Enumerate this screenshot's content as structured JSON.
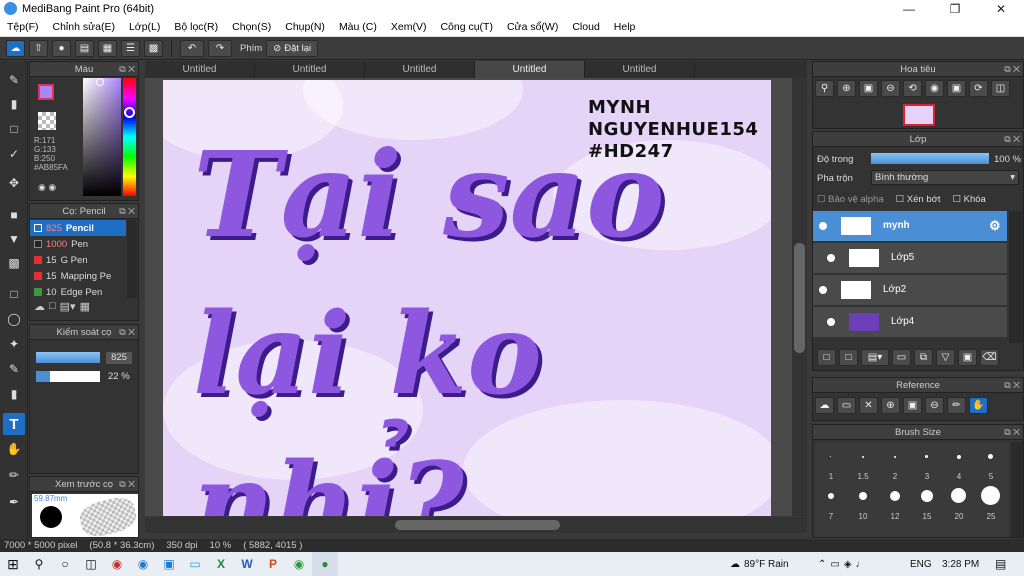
{
  "app": {
    "title": "MediBang Paint Pro (64bit)"
  },
  "menu": [
    "Tệp(F)",
    "Chỉnh sửa(E)",
    "Lớp(L)",
    "Bộ lọc(R)",
    "Chọn(S)",
    "Chụp(N)",
    "Màu (C)",
    "Xem(V)",
    "Công cụ(T)",
    "Cửa sổ(W)",
    "Cloud",
    "Help"
  ],
  "toolbar": {
    "shortcut_label": "Phím",
    "undo_label": "Đặt lại"
  },
  "tabs": [
    "Untitled",
    "Untitled",
    "Untitled",
    "Untitled",
    "Untitled"
  ],
  "color_panel": {
    "title": "Màu",
    "r": "R:171",
    "g": "G:133",
    "b": "B:250",
    "hex": "#AB85FA",
    "current": "#ab85fa"
  },
  "brush_panel": {
    "title": "Cọ: Pencil",
    "items": [
      {
        "size": "825",
        "name": "Pencil",
        "color": "#1e6fc4"
      },
      {
        "size": "1000",
        "name": "Pen",
        "color": "#333"
      },
      {
        "size": "15",
        "name": "G Pen",
        "color": "#e03030"
      },
      {
        "size": "15",
        "name": "Mapping Pe",
        "color": "#e03030"
      },
      {
        "size": "10",
        "name": "Edge Pen",
        "color": "#3a9a3a"
      }
    ]
  },
  "brush_control": {
    "title": "Kiểm soát cọ",
    "size": "825",
    "opacity": "22 %"
  },
  "preview": {
    "title": "Xem trước cọ",
    "value": "59.87mm"
  },
  "art": {
    "sig1": "MYNH",
    "sig2": "NGUYENHUE154",
    "sig3": "#HD247",
    "line1": "Tại sao",
    "line2": "lại ko nhỉ?"
  },
  "navigator": {
    "title": "Hoa tiêu"
  },
  "layer_panel": {
    "title": "Lớp",
    "opacity_label": "Độ trong",
    "opacity_value": "100 %",
    "blend_label": "Pha trộn",
    "blend_value": "Bình thường",
    "alpha_label": "Bảo vệ alpha",
    "clip_label": "Xén bớt",
    "lock_label": "Khóa",
    "layers": [
      "mynh",
      "Lớp5",
      "Lớp2",
      "Lớp4"
    ]
  },
  "reference": {
    "title": "Reference"
  },
  "brush_size": {
    "title": "Brush Size",
    "row1": [
      "1",
      "1.5",
      "2",
      "3",
      "4",
      "5"
    ],
    "row2": [
      "7",
      "10",
      "12",
      "15",
      "20",
      "25"
    ]
  },
  "status": {
    "size": "7000 * 5000 pixel",
    "mm": "(50.8 * 36.3cm)",
    "dpi": "350 dpi",
    "zoom": "10 %",
    "coords": "( 5882, 4015 )"
  },
  "taskbar": {
    "weather": "89°F Rain",
    "lang": "ENG",
    "time": "3:28 PM"
  }
}
